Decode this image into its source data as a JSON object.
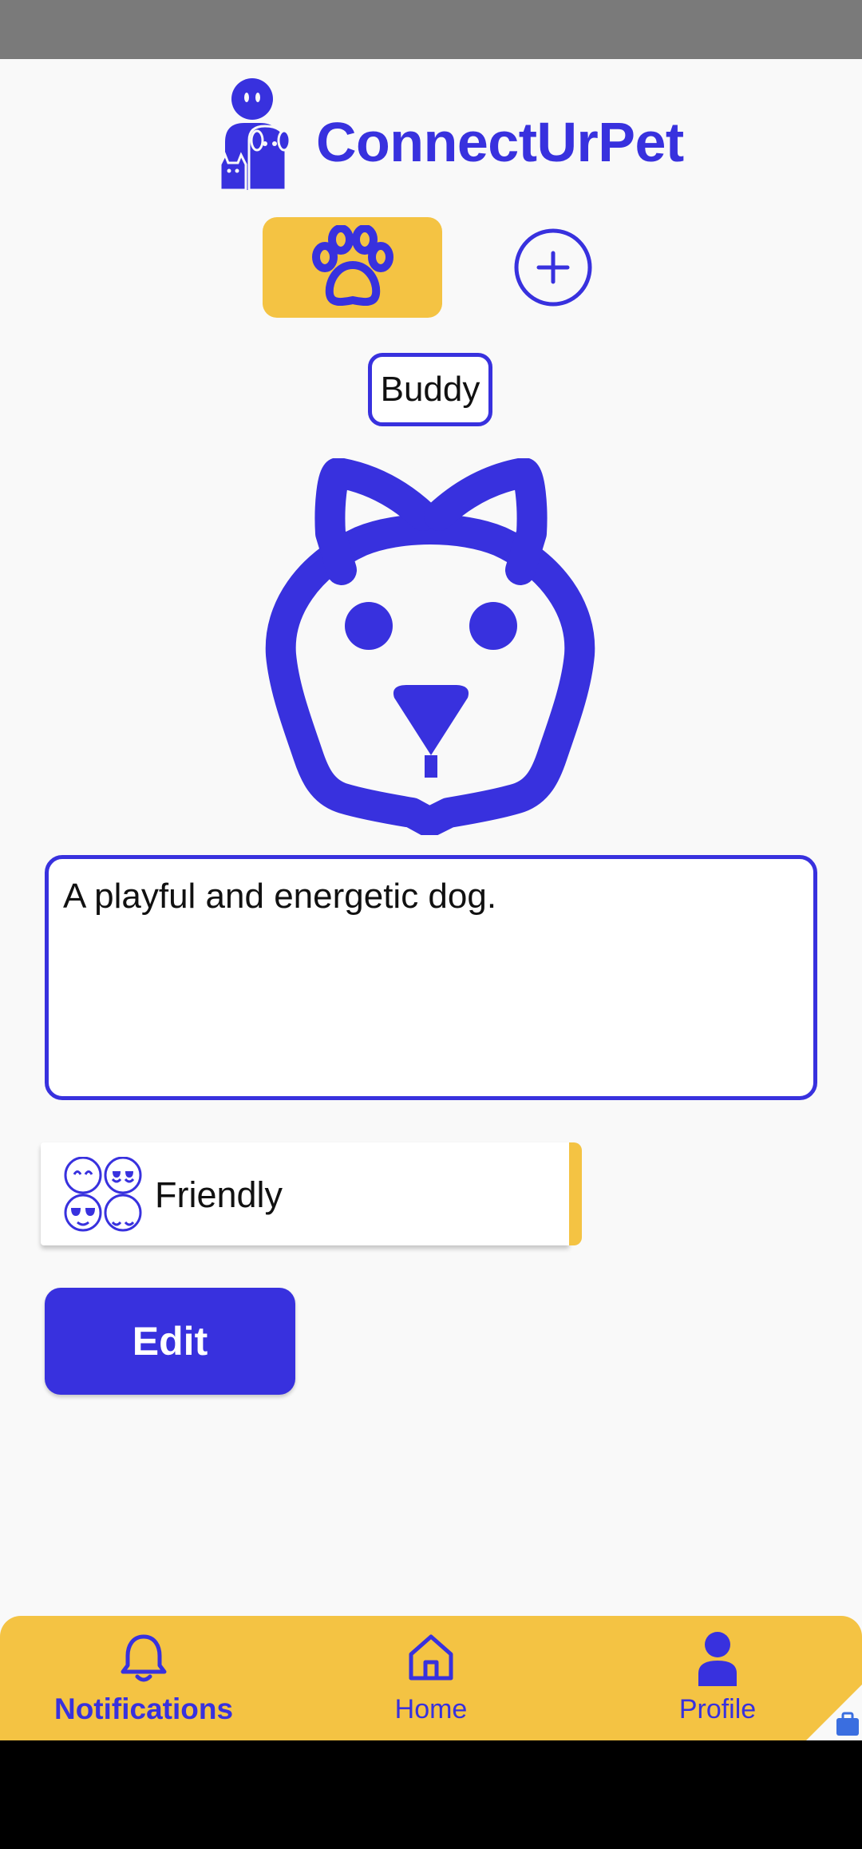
{
  "app": {
    "title": "ConnectUrPet",
    "brand_color": "#3831de",
    "accent_color": "#f4c343"
  },
  "pet_tabs": {
    "selected_icon": "paw-icon",
    "add_icon": "add-circle-icon"
  },
  "pet": {
    "name": "Buddy",
    "avatar_icon": "dog-face-icon",
    "description": "A playful and energetic dog.",
    "trait": {
      "icon": "emoji-faces-icon",
      "label": "Friendly"
    }
  },
  "actions": {
    "edit_label": "Edit"
  },
  "bottom_nav": {
    "items": [
      {
        "label": "Notifications",
        "icon": "bell-icon",
        "active": true
      },
      {
        "label": "Home",
        "icon": "home-icon",
        "active": false
      },
      {
        "label": "Profile",
        "icon": "person-icon",
        "active": false
      }
    ]
  }
}
